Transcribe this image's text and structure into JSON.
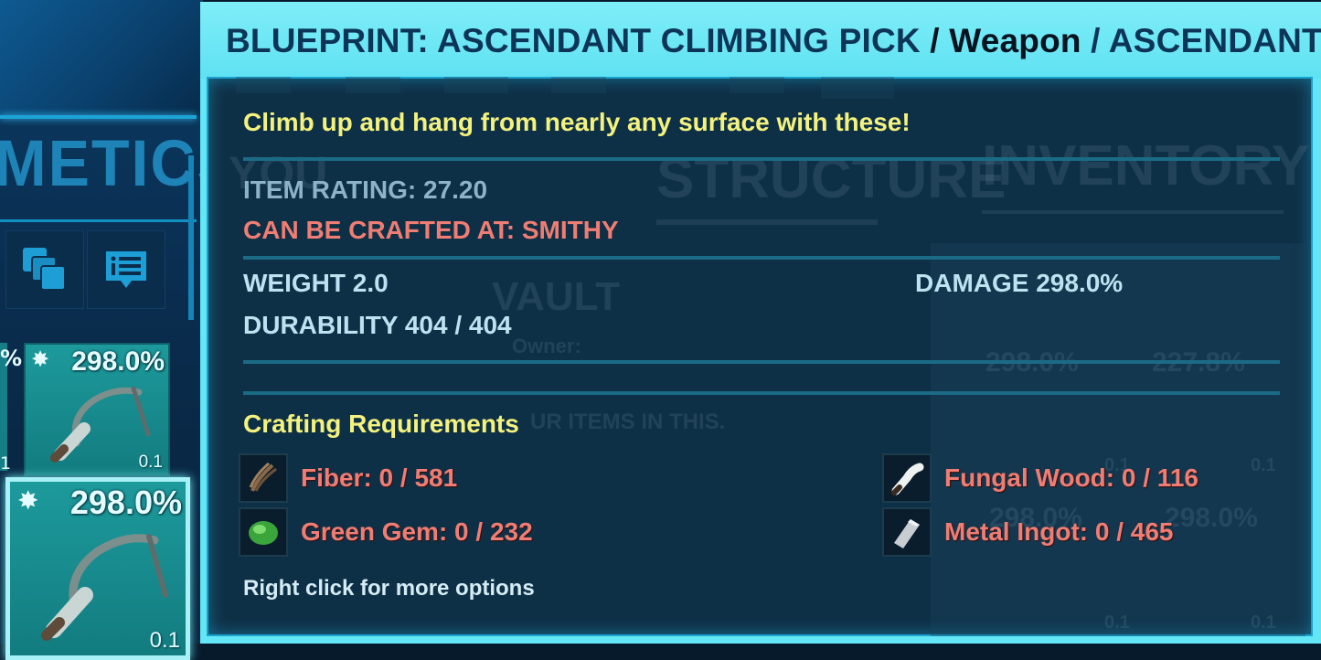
{
  "background": {
    "section_title": "METICS",
    "slots": [
      {
        "stat": "298.0%",
        "weight": "0.1"
      },
      {
        "stat": "298.0%",
        "weight": "0.1"
      }
    ],
    "partial_slot_text": "%",
    "partial_slot_weight": "1",
    "ghost_labels": {
      "structure": "STRUCTURE",
      "inventory": "INVENTORY",
      "vault": "VAULT",
      "owner": "Owner:",
      "vault_hint": "UR ITEMS IN THIS.",
      "stat_1": "298.0%",
      "stat_2": "227.8%",
      "stat_3": "298.0%",
      "stat_4": "298.0%",
      "weight_1": "0.1",
      "weight_2": "0.1",
      "weight_3": "0.1",
      "weight_4": "0.1",
      "you": "YOU"
    }
  },
  "tooltip": {
    "title_main": "BLUEPRINT: ASCENDANT CLIMBING PICK",
    "title_sep1": " / ",
    "title_category": "Weapon",
    "title_sep2": " / ",
    "title_quality": "ASCENDANT",
    "description": "Climb up and hang from nearly any surface with these!",
    "item_rating": "ITEM RATING: 27.20",
    "crafted_at": "CAN BE CRAFTED AT: SMITHY",
    "weight": "WEIGHT 2.0",
    "damage": "DAMAGE 298.0%",
    "durability": "DURABILITY 404 / 404",
    "requirements_title": "Crafting Requirements",
    "requirements": [
      {
        "label": "Fiber: 0 / 581",
        "icon": "fiber-icon"
      },
      {
        "label": "Fungal Wood: 0 / 116",
        "icon": "fungal-wood-icon"
      },
      {
        "label": "Green Gem: 0 / 232",
        "icon": "green-gem-icon"
      },
      {
        "label": "Metal Ingot: 0 / 465",
        "icon": "metal-ingot-icon"
      }
    ],
    "hint": "Right click for more options"
  },
  "colors": {
    "header_bg": "#63e6f6",
    "title_text": "#0d3557",
    "description_yellow": "#f4f27e",
    "missing_red": "#f07d73",
    "stat_text": "#bde3f1",
    "slot_teal": "#1d9a9c"
  }
}
